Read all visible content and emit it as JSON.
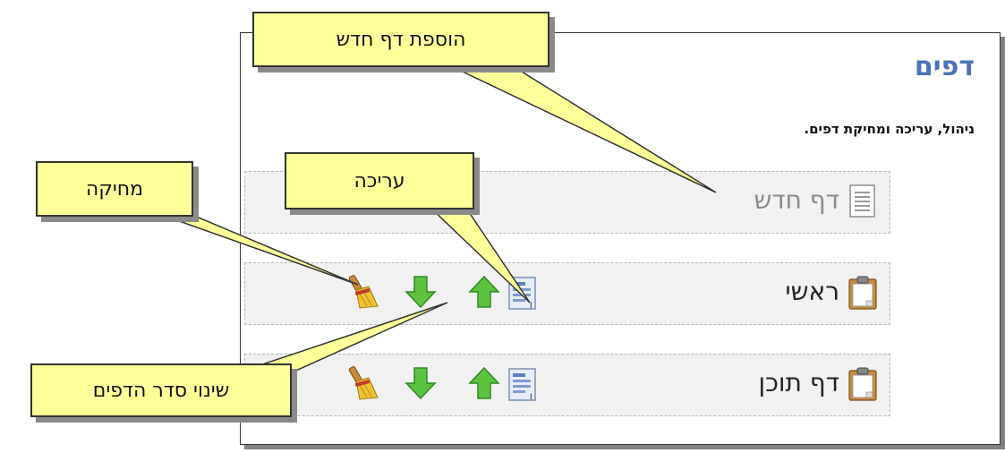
{
  "panel": {
    "title": "דפים",
    "subtitle": "ניהול, עריכה ומחיקת דפים."
  },
  "rows": [
    {
      "label": "דף חדש",
      "icon": "new-page-icon",
      "label_color": "#8a8a8a"
    },
    {
      "label": "ראשי",
      "icon": "clipboard-page-icon",
      "label_color": "#222222"
    },
    {
      "label": "דף תוכן",
      "icon": "clipboard-page-icon",
      "label_color": "#222222"
    }
  ],
  "actions": {
    "edit_icon": "edit-document-icon",
    "move_up_icon": "green-up-arrow-icon",
    "move_down_icon": "green-down-arrow-icon",
    "delete_icon": "broom-icon"
  },
  "callouts": {
    "add_page": "הוספת דף חדש",
    "edit": "עריכה",
    "delete": "מחיקה",
    "reorder": "שינוי סדר הדפים"
  },
  "colors": {
    "title": "#4a72b8",
    "callout_fill": "#ffff99",
    "row_fill": "#f1f1f1",
    "arrow_green": "#5cc341"
  }
}
